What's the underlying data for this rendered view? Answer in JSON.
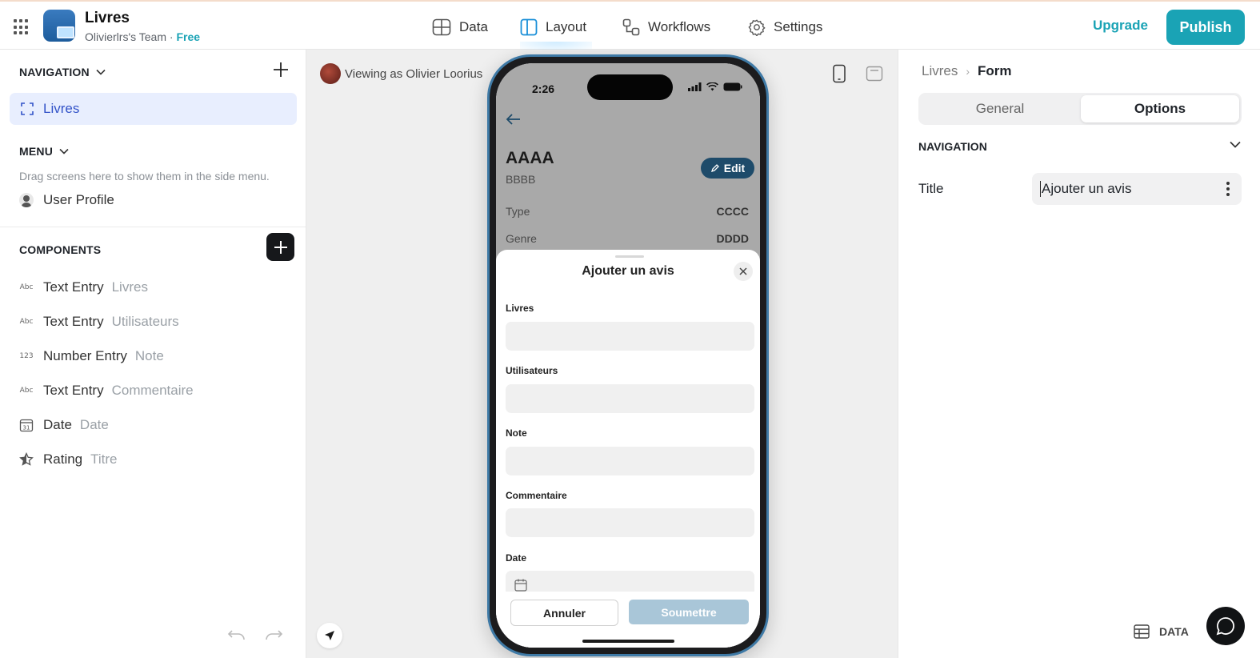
{
  "app": {
    "name": "Livres",
    "team": "Olivierlrs's Team",
    "separator": "·",
    "plan": "Free"
  },
  "topnav": {
    "data": "Data",
    "layout": "Layout",
    "workflows": "Workflows",
    "settings": "Settings"
  },
  "actions": {
    "upgrade": "Upgrade",
    "publish": "Publish"
  },
  "left": {
    "navigation": {
      "title": "NAVIGATION",
      "item": "Livres"
    },
    "menu": {
      "title": "MENU",
      "hint": "Drag screens here to show them in the side menu.",
      "item": "User Profile"
    },
    "components": {
      "title": "COMPONENTS",
      "items": [
        {
          "icon": "Abc",
          "type": "Text Entry",
          "field": "Livres"
        },
        {
          "icon": "Abc",
          "type": "Text Entry",
          "field": "Utilisateurs"
        },
        {
          "icon": "123",
          "type": "Number Entry",
          "field": "Note"
        },
        {
          "icon": "Abc",
          "type": "Text Entry",
          "field": "Commentaire"
        },
        {
          "icon": "31",
          "type": "Date",
          "field": "Date"
        },
        {
          "icon": "star-icon",
          "type": "Rating",
          "field": "Titre"
        }
      ]
    }
  },
  "canvas": {
    "viewing_as": "Viewing as Olivier Loorius",
    "phone": {
      "time": "2:26",
      "record": {
        "title": "AAAA",
        "subtitle": "BBBB",
        "edit": "Edit",
        "rows": [
          {
            "label": "Type",
            "value": "CCCC"
          },
          {
            "label": "Genre",
            "value": "DDDD"
          }
        ]
      },
      "sheet": {
        "title": "Ajouter un avis",
        "fields": [
          "Livres",
          "Utilisateurs",
          "Note",
          "Commentaire",
          "Date"
        ],
        "cancel": "Annuler",
        "submit": "Soumettre"
      }
    }
  },
  "right": {
    "breadcrumb": {
      "parent": "Livres",
      "current": "Form"
    },
    "tabs": {
      "general": "General",
      "options": "Options"
    },
    "section": "NAVIGATION",
    "title_label": "Title",
    "title_value": "Ajouter un avis",
    "data_button": "DATA"
  },
  "colors": {
    "accent": "#1aa3b5",
    "selected_nav": "#e8eefe",
    "edit_button": "#1e4b6a",
    "submit_disabled": "#a9c6d8"
  }
}
